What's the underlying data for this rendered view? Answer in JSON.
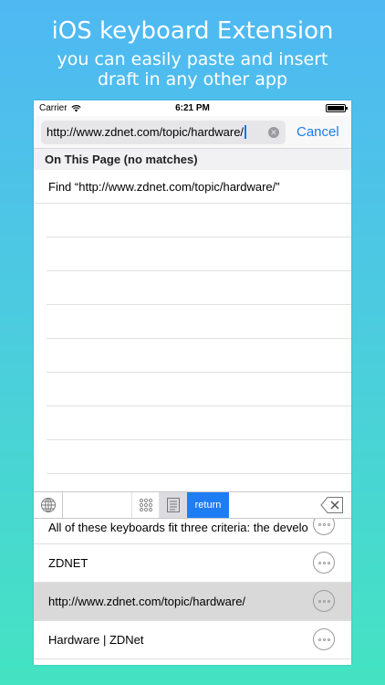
{
  "headline": {
    "title": "iOS keyboard Extension",
    "subtitle_line1": "you can easily paste and insert",
    "subtitle_line2": "draft in any other app"
  },
  "status_bar": {
    "carrier": "Carrier",
    "time": "6:21 PM"
  },
  "nav": {
    "url_value": "http://www.zdnet.com/topic/hardware/",
    "cancel_label": "Cancel"
  },
  "find": {
    "section_header": "On This Page (no matches)",
    "find_row": "Find “http://www.zdnet.com/topic/hardware/”"
  },
  "keyboard": {
    "return_label": "return",
    "accent_color": "#1f7df4"
  },
  "drafts": [
    {
      "text": "All of these keyboards fit three criteria: the developer's own"
    },
    {
      "text": "ZDNET"
    },
    {
      "text": "http://www.zdnet.com/topic/hardware/"
    },
    {
      "text": "Hardware | ZDNet"
    }
  ]
}
